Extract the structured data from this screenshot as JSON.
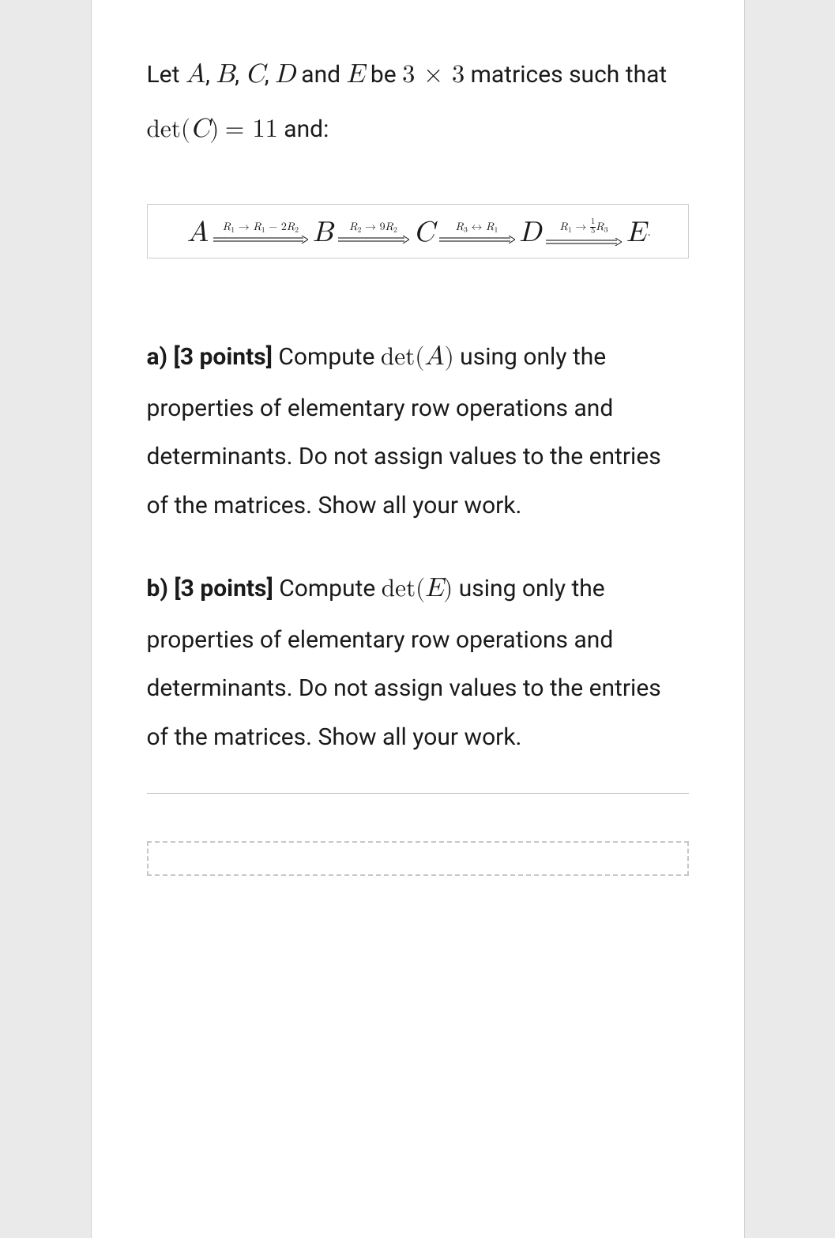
{
  "problem": {
    "intro": {
      "let": "Let",
      "matrix_list": [
        "A",
        "B",
        "C",
        "D"
      ],
      "and_word1": "and",
      "last_matrix": "E",
      "be_word": "be",
      "matrix_size": "3 × 3",
      "tail1": "matrices such that",
      "det_label": "det",
      "det_arg": "C",
      "det_val": "11",
      "and_colon": "and:"
    },
    "row_ops": [
      {
        "from": "A",
        "to": "B",
        "label_kind": "replace",
        "label": "R₁ → R₁ − 2R₂",
        "arrow_w": 120
      },
      {
        "from": "B",
        "to": "C",
        "label_kind": "scale",
        "label": "R₂ → 9R₂",
        "arrow_w": 90
      },
      {
        "from": "C",
        "to": "D",
        "label_kind": "swap",
        "label": "R₃ ↔ R₁",
        "arrow_w": 96
      },
      {
        "from": "D",
        "to": "E",
        "label_kind": "scalefrac",
        "label_prefix": "R₁ →",
        "frac_num": "1",
        "frac_den": "5",
        "label_suffix": "R₃",
        "arrow_w": 96
      }
    ],
    "parts": {
      "a": {
        "tag": "a) [3 points]",
        "pre": "Compute",
        "expr_fn": "det",
        "expr_arg": "A",
        "post": "using only the properties of elementary row operations and determinants. Do not assign values to the entries of the matrices. Show all your work."
      },
      "b": {
        "tag": "b) [3 points]",
        "pre": "Compute",
        "expr_fn": "det",
        "expr_arg": "E",
        "post": "using only the properties of elementary row operations and determinants. Do not assign values to the entries of the matrices. Show all your work."
      }
    }
  }
}
